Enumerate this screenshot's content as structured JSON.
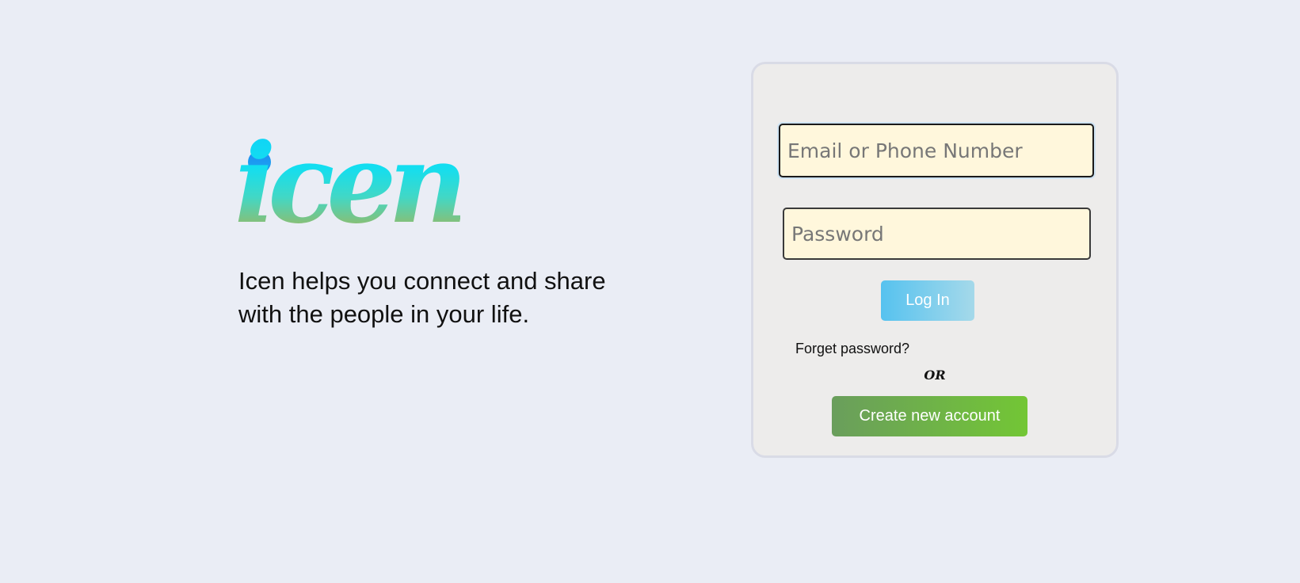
{
  "brand": {
    "logo_text": "icen",
    "tagline": "Icen helps you connect and share with the people in your life."
  },
  "login": {
    "email_placeholder": "Email or Phone Number",
    "password_placeholder": "Password",
    "login_label": "Log In",
    "forgot_label": "Forget password?",
    "or_label": "OR",
    "create_label": "Create new account"
  },
  "colors": {
    "background": "#eaedf5",
    "card": "#edeceb",
    "input_fill": "#fff7dc",
    "login_button": "#56c2ef",
    "create_button": "#73c635"
  }
}
